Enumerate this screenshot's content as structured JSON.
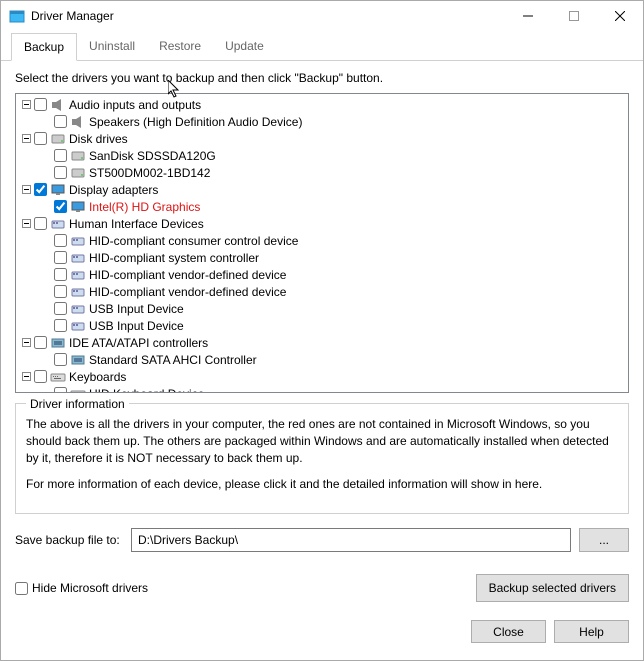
{
  "window": {
    "title": "Driver Manager"
  },
  "tabs": {
    "backup": "Backup",
    "uninstall": "Uninstall",
    "restore": "Restore",
    "update": "Update"
  },
  "instruction": "Select the drivers you want to backup and then click \"Backup\" button.",
  "tree": [
    {
      "level": 0,
      "expanded": true,
      "checked": false,
      "icon": "audio",
      "label": "Audio inputs and outputs"
    },
    {
      "level": 1,
      "expanded": null,
      "checked": false,
      "icon": "audio",
      "label": "Speakers (High Definition Audio Device)"
    },
    {
      "level": 0,
      "expanded": true,
      "checked": false,
      "icon": "disk",
      "label": "Disk drives"
    },
    {
      "level": 1,
      "expanded": null,
      "checked": false,
      "icon": "disk",
      "label": "SanDisk SDSSDA120G"
    },
    {
      "level": 1,
      "expanded": null,
      "checked": false,
      "icon": "disk",
      "label": "ST500DM002-1BD142"
    },
    {
      "level": 0,
      "expanded": true,
      "checked": true,
      "icon": "display",
      "label": "Display adapters"
    },
    {
      "level": 1,
      "expanded": null,
      "checked": true,
      "icon": "display",
      "label": "Intel(R) HD Graphics",
      "red": true
    },
    {
      "level": 0,
      "expanded": true,
      "checked": false,
      "icon": "hid",
      "label": "Human Interface Devices"
    },
    {
      "level": 1,
      "expanded": null,
      "checked": false,
      "icon": "hid",
      "label": "HID-compliant consumer control device"
    },
    {
      "level": 1,
      "expanded": null,
      "checked": false,
      "icon": "hid",
      "label": "HID-compliant system controller"
    },
    {
      "level": 1,
      "expanded": null,
      "checked": false,
      "icon": "hid",
      "label": "HID-compliant vendor-defined device"
    },
    {
      "level": 1,
      "expanded": null,
      "checked": false,
      "icon": "hid",
      "label": "HID-compliant vendor-defined device"
    },
    {
      "level": 1,
      "expanded": null,
      "checked": false,
      "icon": "hid",
      "label": "USB Input Device"
    },
    {
      "level": 1,
      "expanded": null,
      "checked": false,
      "icon": "hid",
      "label": "USB Input Device"
    },
    {
      "level": 0,
      "expanded": true,
      "checked": false,
      "icon": "ide",
      "label": "IDE ATA/ATAPI controllers"
    },
    {
      "level": 1,
      "expanded": null,
      "checked": false,
      "icon": "ide",
      "label": "Standard SATA AHCI Controller"
    },
    {
      "level": 0,
      "expanded": true,
      "checked": false,
      "icon": "keyboard",
      "label": "Keyboards"
    },
    {
      "level": 1,
      "expanded": null,
      "checked": false,
      "icon": "keyboard",
      "label": "HID Keyboard Device"
    }
  ],
  "fieldset": {
    "legend": "Driver information",
    "p1": "The above is all the drivers in your computer, the red ones are not contained in Microsoft Windows, so you should back them up. The others are packaged within Windows and are automatically installed when detected by it, therefore it is NOT necessary to back them up.",
    "p2": "For more information of each device, please click it and the detailed information will show in here."
  },
  "save": {
    "label": "Save backup file to:",
    "path": "D:\\Drivers Backup\\",
    "browse": "..."
  },
  "hide_ms": "Hide Microsoft drivers",
  "backup_btn": "Backup selected drivers",
  "footer": {
    "close": "Close",
    "help": "Help"
  }
}
